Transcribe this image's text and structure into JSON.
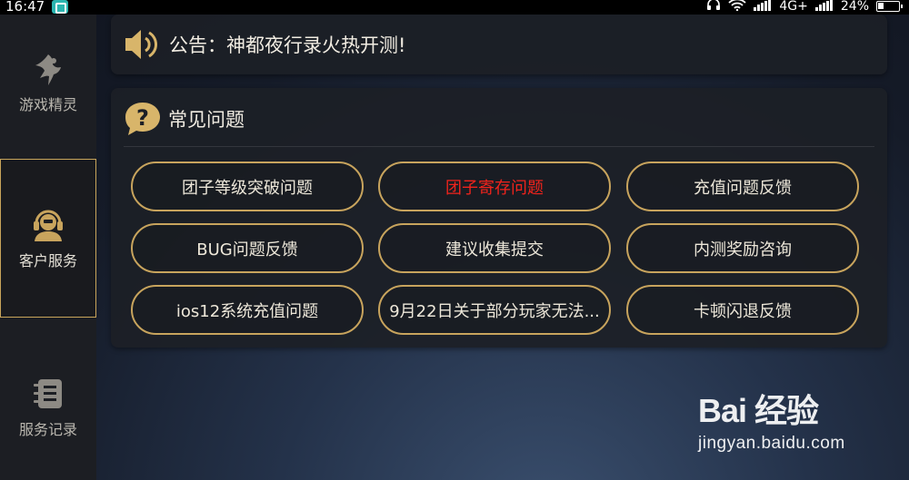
{
  "status_bar": {
    "time": "16:47",
    "network": "4G+",
    "battery": "24%"
  },
  "sidebar": {
    "items": [
      {
        "label": "游戏精灵",
        "icon": "fairy-icon",
        "active": false
      },
      {
        "label": "客户服务",
        "icon": "customer-service-icon",
        "active": true
      },
      {
        "label": "服务记录",
        "icon": "record-list-icon",
        "active": false
      }
    ]
  },
  "announcement": {
    "text": "公告：神都夜行录火热开测!"
  },
  "faq": {
    "title": "常见问题",
    "buttons": [
      {
        "label": "团子等级突破问题",
        "highlight": false
      },
      {
        "label": "团子寄存问题",
        "highlight": true
      },
      {
        "label": "充值问题反馈",
        "highlight": false
      },
      {
        "label": "BUG问题反馈",
        "highlight": false
      },
      {
        "label": "建议收集提交",
        "highlight": false
      },
      {
        "label": "内测奖励咨询",
        "highlight": false
      },
      {
        "label": "ios12系统充值问题",
        "highlight": false
      },
      {
        "label": "9月22日关于部分玩家无法...",
        "highlight": false
      },
      {
        "label": "卡顿闪退反馈",
        "highlight": false
      }
    ]
  },
  "watermark": {
    "brand": "Bai  经验",
    "url": "jingyan.baidu.com"
  },
  "colors": {
    "accent_gold": "#c8a45d",
    "highlight_red": "#f0231c",
    "sidebar_bg": "#1c1e23"
  }
}
